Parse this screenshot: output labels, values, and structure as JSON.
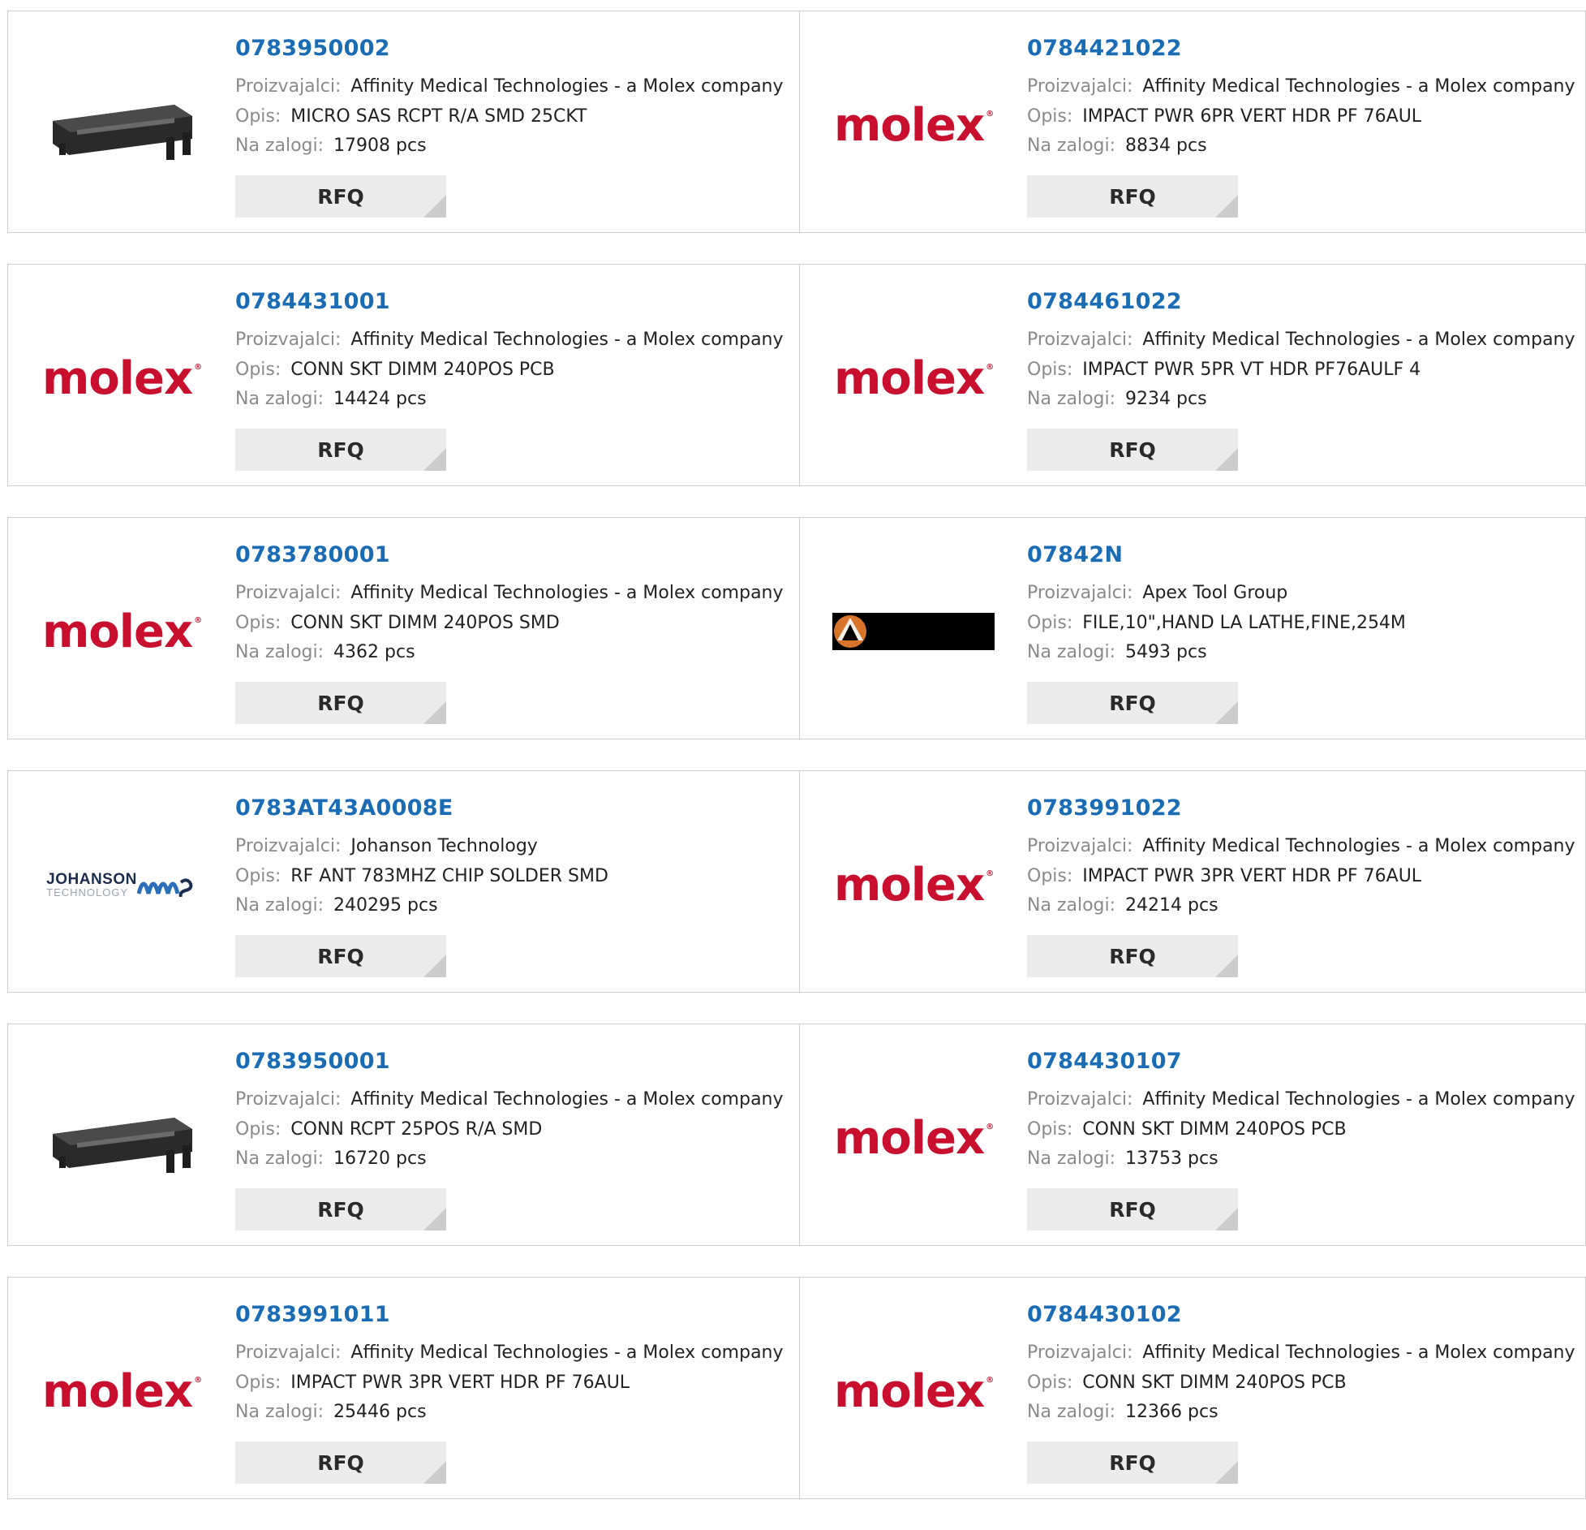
{
  "labels": {
    "manufacturer": "Proizvajalci:",
    "description": "Opis:",
    "stock": "Na zalogi:",
    "rfq": "RFQ"
  },
  "colors": {
    "link": "#1a6cb5",
    "molex_red": "#c8102e",
    "label_gray": "#8a8a8a",
    "button_bg": "#ececec"
  },
  "products": [
    {
      "part": "0783950002",
      "manufacturer": "Affinity Medical Technologies - a Molex company",
      "description": "MICRO SAS RCPT R/A SMD 25CKT",
      "stock": "17908 pcs",
      "image": "connector-photo"
    },
    {
      "part": "0784421022",
      "manufacturer": "Affinity Medical Technologies - a Molex company",
      "description": "IMPACT PWR 6PR VERT HDR PF 76AUL",
      "stock": "8834 pcs",
      "image": "molex-logo"
    },
    {
      "part": "0784431001",
      "manufacturer": "Affinity Medical Technologies - a Molex company",
      "description": "CONN SKT DIMM 240POS PCB",
      "stock": "14424 pcs",
      "image": "molex-logo"
    },
    {
      "part": "0784461022",
      "manufacturer": "Affinity Medical Technologies - a Molex company",
      "description": "IMPACT PWR 5PR VT HDR PF76AULF 4",
      "stock": "9234 pcs",
      "image": "molex-logo"
    },
    {
      "part": "0783780001",
      "manufacturer": "Affinity Medical Technologies - a Molex company",
      "description": "CONN SKT DIMM 240POS SMD",
      "stock": "4362 pcs",
      "image": "molex-logo"
    },
    {
      "part": "07842N",
      "manufacturer": "Apex Tool Group",
      "description": "FILE,10\",HAND LA LATHE,FINE,254M",
      "stock": "5493 pcs",
      "image": "apex-logo"
    },
    {
      "part": "0783AT43A0008E",
      "manufacturer": "Johanson Technology",
      "description": "RF ANT 783MHZ CHIP SOLDER SMD",
      "stock": "240295 pcs",
      "image": "johanson-logo"
    },
    {
      "part": "0783991022",
      "manufacturer": "Affinity Medical Technologies - a Molex company",
      "description": "IMPACT PWR 3PR VERT HDR PF 76AUL",
      "stock": "24214 pcs",
      "image": "molex-logo"
    },
    {
      "part": "0783950001",
      "manufacturer": "Affinity Medical Technologies - a Molex company",
      "description": "CONN RCPT 25POS R/A SMD",
      "stock": "16720 pcs",
      "image": "connector-photo"
    },
    {
      "part": "0784430107",
      "manufacturer": "Affinity Medical Technologies - a Molex company",
      "description": "CONN SKT DIMM 240POS PCB",
      "stock": "13753 pcs",
      "image": "molex-logo"
    },
    {
      "part": "0783991011",
      "manufacturer": "Affinity Medical Technologies - a Molex company",
      "description": "IMPACT PWR 3PR VERT HDR PF 76AUL",
      "stock": "25446 pcs",
      "image": "molex-logo"
    },
    {
      "part": "0784430102",
      "manufacturer": "Affinity Medical Technologies - a Molex company",
      "description": "CONN SKT DIMM 240POS PCB",
      "stock": "12366 pcs",
      "image": "molex-logo"
    }
  ],
  "logos": {
    "molex": "molex",
    "johanson_line1": "JOHANSON",
    "johanson_line2": "TECHNOLOGY"
  }
}
